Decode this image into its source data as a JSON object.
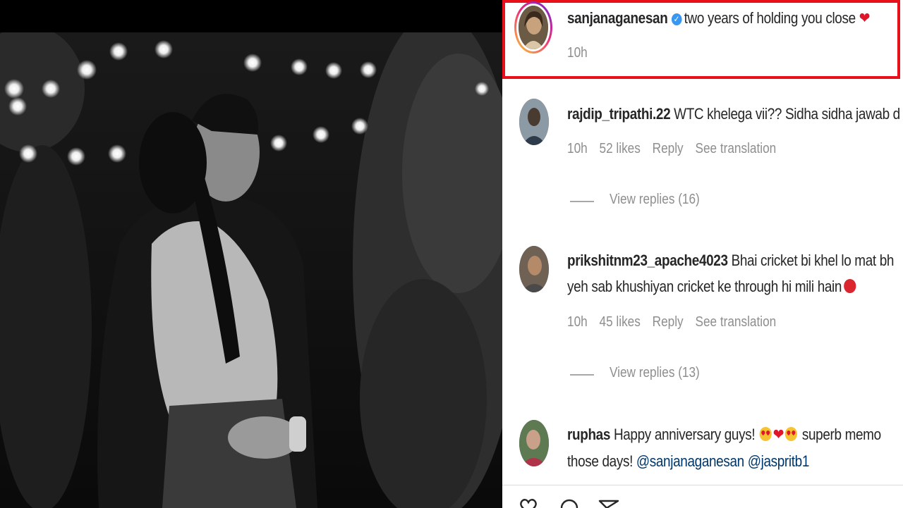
{
  "post": {
    "author": "sanjanaganesan",
    "caption": "two years of holding you close",
    "caption_emoji": "❤",
    "time": "10h"
  },
  "comments": [
    {
      "username": "rajdip_tripathi.22",
      "text": "WTC khelega vii?? Sidha sidha jawab d",
      "time": "10h",
      "likes": "52 likes",
      "reply": "Reply",
      "translate": "See translation",
      "view_replies": "View replies (16)"
    },
    {
      "username": "prikshitnm23_apache4023",
      "text": "Bhai cricket bi khel lo mat bh",
      "text2": "yeh sab khushiyan cricket ke through hi mili hain",
      "time": "10h",
      "likes": "45 likes",
      "reply": "Reply",
      "translate": "See translation",
      "view_replies": "View replies (13)"
    },
    {
      "username": "ruphas",
      "text": "Happy anniversary guys!",
      "text_after": "superb memo",
      "text2": "those days!",
      "mention1": "@sanjanaganesan",
      "mention2": "@jaspritb1"
    }
  ],
  "icons": [
    "verified-badge-icon",
    "heart-emoji-icon",
    "heart-eyes-emoji-icon",
    "angry-emoji-icon",
    "like-heart-icon",
    "comment-bubble-icon",
    "share-icon"
  ],
  "colors": {
    "highlight_border": "#e8101a",
    "verified": "#3897f0",
    "muted_text": "#8e8e8e",
    "mention": "#00376b"
  }
}
